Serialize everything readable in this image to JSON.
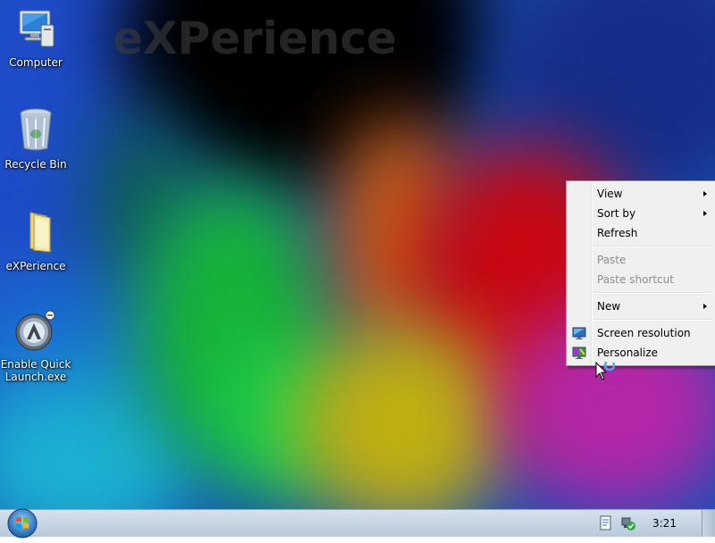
{
  "wallpaper": {
    "watermark": "eXPerience"
  },
  "desktop_icons": [
    {
      "label": "Computer",
      "icon": "computer-icon"
    },
    {
      "label": "Recycle Bin",
      "icon": "recycle-bin-icon"
    },
    {
      "label": "eXPerience",
      "icon": "folder-icon"
    },
    {
      "label": "Enable Quick Launch.exe",
      "icon": "app-icon"
    }
  ],
  "context_menu": {
    "items": [
      {
        "label": "View",
        "submenu": true,
        "enabled": true
      },
      {
        "label": "Sort by",
        "submenu": true,
        "enabled": true
      },
      {
        "label": "Refresh",
        "submenu": false,
        "enabled": true
      },
      {
        "label": "Paste",
        "submenu": false,
        "enabled": false
      },
      {
        "label": "Paste shortcut",
        "submenu": false,
        "enabled": false
      },
      {
        "label": "New",
        "submenu": true,
        "enabled": true
      },
      {
        "label": "Screen resolution",
        "submenu": false,
        "enabled": true,
        "icon": "screen-resolution-icon"
      },
      {
        "label": "Personalize",
        "submenu": false,
        "enabled": true,
        "icon": "personalize-icon"
      }
    ]
  },
  "taskbar": {
    "clock": "3:21",
    "tray_icons": [
      "notification-icon",
      "network-icon"
    ]
  },
  "colors": {
    "taskbar": "#c7d5e3",
    "menu_background": "#f0f0f0",
    "disabled_text": "#8d8d8d"
  }
}
